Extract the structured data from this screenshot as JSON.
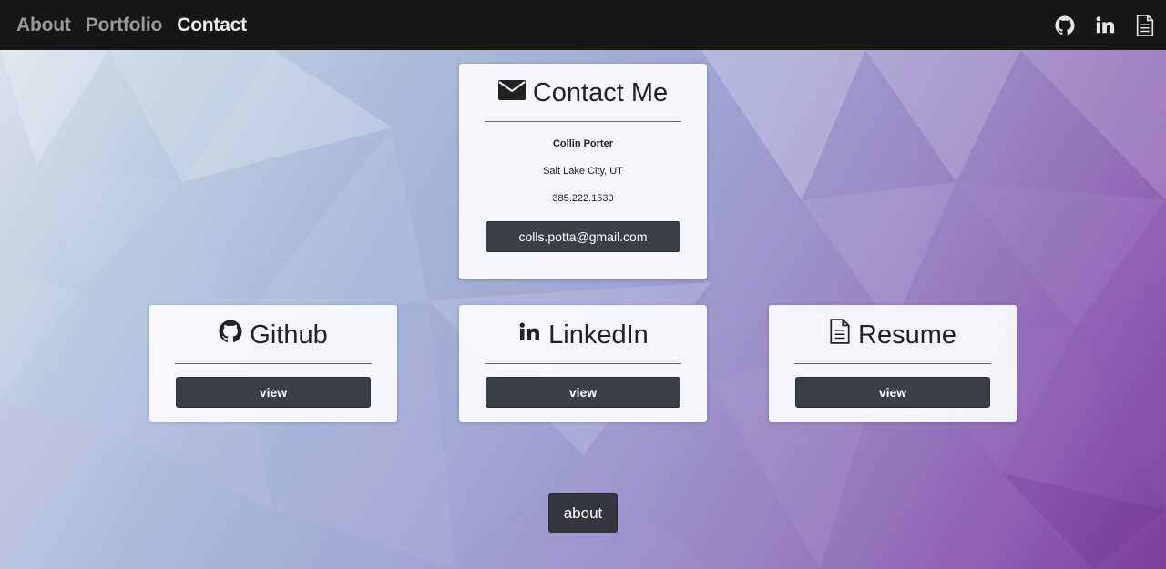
{
  "nav": {
    "links": [
      {
        "label": "About",
        "active": false
      },
      {
        "label": "Portfolio",
        "active": false
      },
      {
        "label": "Contact",
        "active": true
      }
    ],
    "icons": [
      "github-icon",
      "linkedin-icon",
      "document-icon"
    ]
  },
  "contact": {
    "title": "Contact Me",
    "icon": "envelope-icon",
    "name": "Collin Porter",
    "city": "Salt Lake City, UT",
    "phone": "385.222.1530",
    "email": "colls.potta@gmail.com"
  },
  "cards": [
    {
      "title": "Github",
      "icon": "github-icon",
      "button": "view"
    },
    {
      "title": "LinkedIn",
      "icon": "linkedin-icon",
      "button": "view"
    },
    {
      "title": "Resume",
      "icon": "document-icon",
      "button": "view"
    }
  ],
  "footer": {
    "about_label": "about"
  },
  "colors": {
    "nav_bg": "#161616",
    "nav_active": "#ededed",
    "nav_inactive": "#9a9a9a",
    "button_bg": "#3b3f47",
    "card_bg": "#f8f8fc"
  }
}
